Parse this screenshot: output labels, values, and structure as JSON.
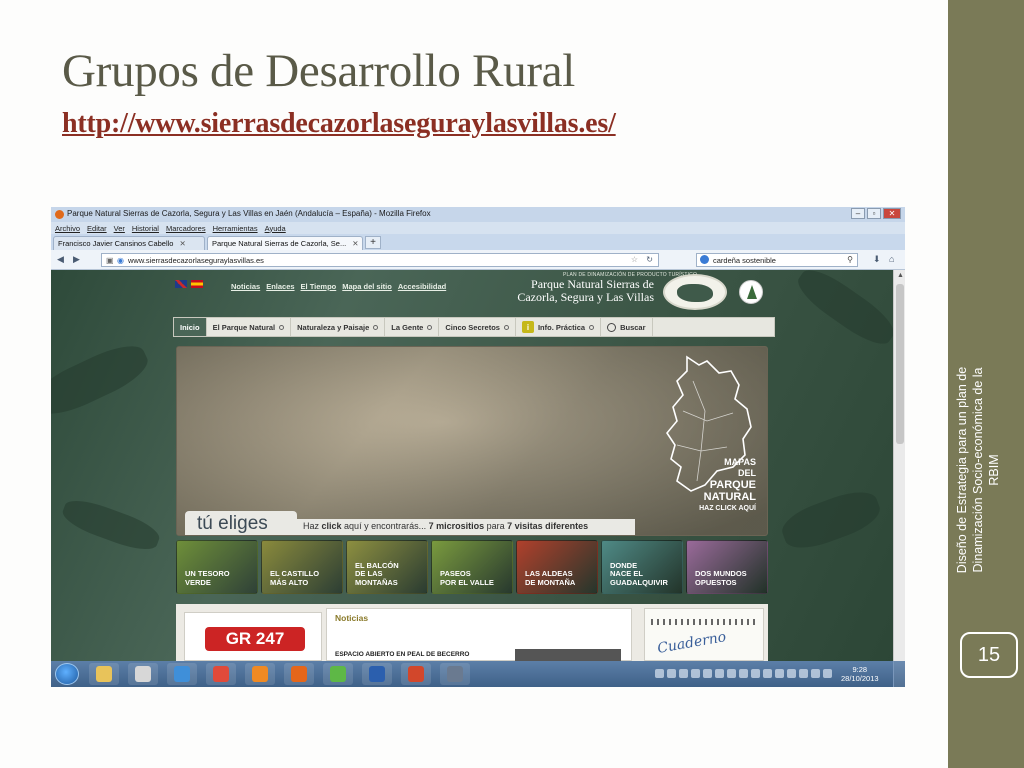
{
  "slide": {
    "title": "Grupos de Desarrollo Rural",
    "link": "http://www.sierrasdecazorlaseguraylasvillas.es/",
    "sidebar_text": "Diseño de Estrategia  para un plan de Dinamización Socio-económica de la RBIM",
    "page_number": "15",
    "colors": {
      "sidebar": "#7a7a57",
      "title": "#5a5a48",
      "link": "#8b2f23"
    }
  },
  "browser": {
    "window_title": "Parque Natural Sierras de Cazorla, Segura y Las Villas en Jaén (Andalucía – España) - Mozilla Firefox",
    "window_buttons": [
      "–",
      "▫",
      "✕"
    ],
    "menu": [
      "Archivo",
      "Editar",
      "Ver",
      "Historial",
      "Marcadores",
      "Herramientas",
      "Ayuda"
    ],
    "tabs": [
      {
        "label": "Francisco Javier Cansinos Cabello",
        "close": "✕"
      },
      {
        "label": "Parque Natural Sierras de Cazorla, Se...",
        "close": "✕"
      }
    ],
    "new_tab": "+",
    "url": "www.sierrasdecazorlaseguraylasvillas.es",
    "search_value": "cardeña sostenible"
  },
  "site": {
    "top_links": [
      "Noticias",
      "Enlaces",
      "El Tiempo",
      "Mapa del sitio",
      "Accesibilidad"
    ],
    "brand_small": "PLAN DE DINAMIZACIÓN DE PRODUCTO TURÍSTICO",
    "brand_line1": "Parque Natural Sierras de",
    "brand_line2": "Cazorla, Segura y Las Villas",
    "nav": [
      "Inicio",
      "El Parque Natural",
      "Naturaleza y Paisaje",
      "La Gente",
      "Cinco Secretos",
      "Info. Práctica",
      "Buscar"
    ],
    "hero": {
      "tu_eliges": "tú eliges",
      "cta_pre": "Haz ",
      "cta_click": "click",
      "cta_mid": " aquí y encontrarás... ",
      "cta_bold": "7 micrositios",
      "cta_mid2": " para ",
      "cta_bold2": "7 visitas diferentes",
      "mapas_line1": "MAPAS",
      "mapas_line2": "DEL",
      "mapas_line3": "PARQUE",
      "mapas_line4": "NATURAL",
      "mapas_line5": "HAZ CLICK AQUÍ"
    },
    "tiles": [
      {
        "l1": "UN TESORO",
        "l2": "VERDE",
        "l3": "",
        "color": "#6f8f3a"
      },
      {
        "l1": "EL CASTILLO",
        "l2": "MÁS ALTO",
        "l3": "",
        "color": "#8a8a3c"
      },
      {
        "l1": "EL BALCÓN",
        "l2": "DE LAS",
        "l3": "MONTAÑAS",
        "color": "#8d8f40"
      },
      {
        "l1": "PASEOS",
        "l2": "POR EL VALLE",
        "l3": "",
        "color": "#7a9a3e"
      },
      {
        "l1": "LAS ALDEAS",
        "l2": "DE MONTAÑA",
        "l3": "",
        "color": "#b0402c"
      },
      {
        "l1": "DONDE",
        "l2": "NACE EL",
        "l3": "GUADALQUIVIR",
        "color": "#4f8a86"
      },
      {
        "l1": "DOS MUNDOS",
        "l2": "OPUESTOS",
        "l3": "",
        "color": "#9a6a9a"
      }
    ],
    "gr_label": "GR 247",
    "news_title": "Noticias",
    "news_item": "ESPACIO ABIERTO EN PEAL DE BECERRO",
    "notebook_text": "Cuaderno"
  },
  "taskbar": {
    "time": "9:28",
    "date": "28/10/2013",
    "apps": [
      {
        "name": "explorer-icon",
        "color": "#e8c35a"
      },
      {
        "name": "chrome-alt-icon",
        "color": "#d7d7d7"
      },
      {
        "name": "ie-icon",
        "color": "#3f8fd9"
      },
      {
        "name": "chrome-icon",
        "color": "#e04a3a"
      },
      {
        "name": "media-player-icon",
        "color": "#f08a24"
      },
      {
        "name": "firefox-icon",
        "color": "#e5661a"
      },
      {
        "name": "spotify-icon",
        "color": "#5eb846"
      },
      {
        "name": "word-icon",
        "color": "#2b5fae"
      },
      {
        "name": "powerpoint-icon",
        "color": "#d2472b"
      },
      {
        "name": "app-icon",
        "color": "#6a7a90"
      }
    ]
  }
}
